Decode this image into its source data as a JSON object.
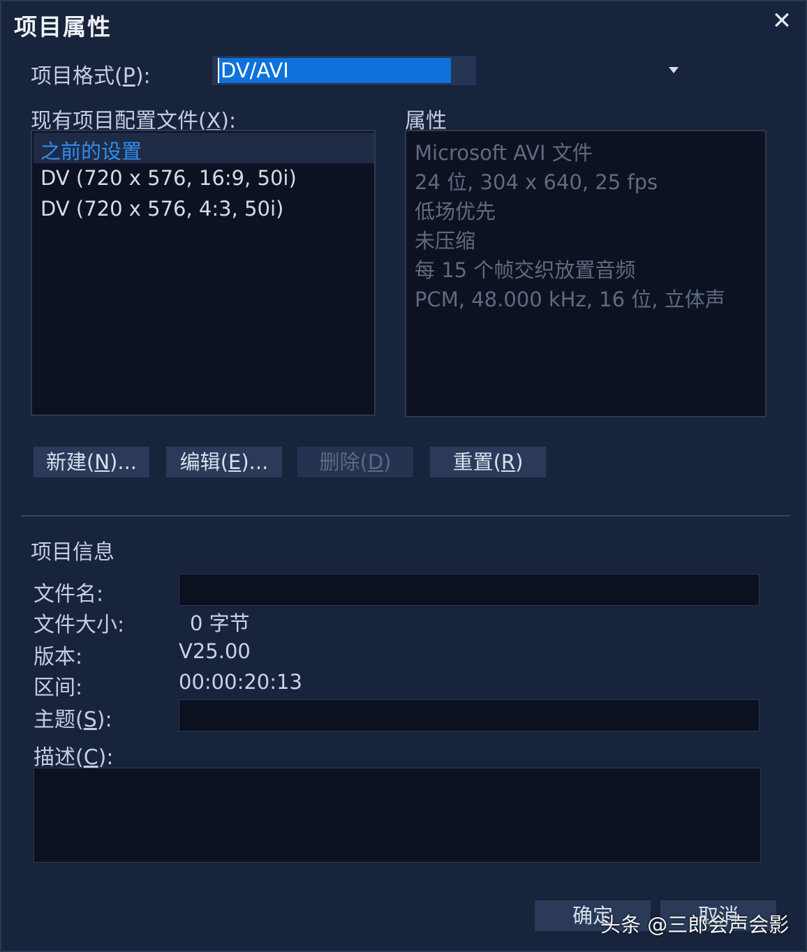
{
  "dialog": {
    "title": "项目属性",
    "close_symbol": "✕"
  },
  "format": {
    "label": "项目格式",
    "mnemonic": "P",
    "value": "DV/AVI"
  },
  "profiles": {
    "label": "现有项目配置文件",
    "mnemonic": "X",
    "items": [
      "之前的设置",
      "DV (720 x 576, 16:9, 50i)",
      "DV (720 x 576, 4:3, 50i)"
    ],
    "selected_index": 0
  },
  "properties": {
    "label": "属性",
    "lines": [
      "Microsoft AVI 文件",
      "24 位, 304 x 640, 25 fps",
      "低场优先",
      "未压缩",
      "每 15 个帧交织放置音频",
      "PCM, 48.000 kHz, 16 位, 立体声"
    ]
  },
  "buttons": {
    "new": {
      "label": "新建",
      "mnemonic": "N",
      "suffix": ")..."
    },
    "edit": {
      "label": "编辑",
      "mnemonic": "E",
      "suffix": ")..."
    },
    "delete": {
      "label": "删除",
      "mnemonic": "D",
      "suffix": ")"
    },
    "reset": {
      "label": "重置",
      "mnemonic": "R",
      "suffix": ")"
    }
  },
  "info": {
    "section_title": "项目信息",
    "filename_label": "文件名:",
    "filename_value": "",
    "filesize_label": "文件大小:",
    "filesize_value": "0 字节",
    "version_label": "版本:",
    "version_value": "V25.00",
    "duration_label": "区间:",
    "duration_value": "00:00:20:13",
    "subject_label": "主题",
    "subject_mnemonic": "S",
    "subject_value": "",
    "description_label": "描述",
    "description_mnemonic": "C",
    "description_value": ""
  },
  "footer": {
    "ok_label": "确定",
    "cancel_label": "取消",
    "watermark": "头条 @三郎会声会影"
  },
  "colors": {
    "accent": "#0d72d9",
    "selected_text": "#2f8df0",
    "background": "#18233c"
  }
}
